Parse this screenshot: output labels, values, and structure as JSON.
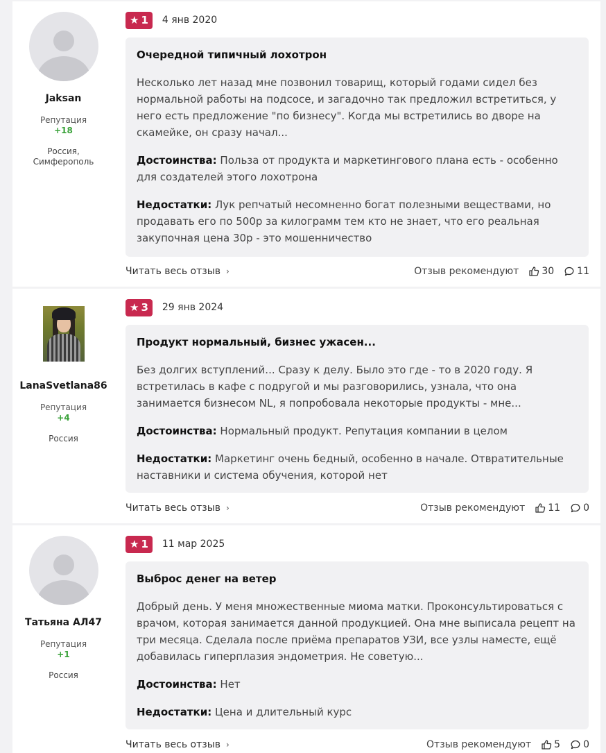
{
  "reviews": [
    {
      "author": {
        "name": "Jaksan",
        "reputation_label": "Репутация",
        "reputation": "+18",
        "location": "Россия, Симферополь"
      },
      "rating": "1",
      "date": "4 янв 2020",
      "title": "Очередной типичный лохотрон",
      "text": "Несколько лет назад мне позвонил товарищ, который годами сидел без нормальной работы на подсосе, и загадочно так предложил встретиться, у него есть предложение \"по бизнесу\". Когда мы встретились во дворе на скамейке, он сразу начал...",
      "pros_label": "Достоинства:",
      "pros": "Польза от продукта и маркетингового плана есть - особенно для создателей этого лохотрона",
      "cons_label": "Недостатки:",
      "cons": "Лук репчатый несомненно богат полезными веществами, но продавать его по 500р за килограмм тем кто не знает, что его реальная закупочная цена 30р - это мошенничество",
      "read_more": "Читать весь отзыв",
      "recommend_label": "Отзыв рекомендуют",
      "likes": "30",
      "comments": "11"
    },
    {
      "author": {
        "name": "LanaSvetlana86",
        "reputation_label": "Репутация",
        "reputation": "+4",
        "location": "Россия"
      },
      "rating": "3",
      "date": "29 янв 2024",
      "title": "Продукт нормальный, бизнес ужасен...",
      "text": "Без долгих вступлений... Сразу к делу. Было это где - то в 2020 году. Я встретилась в кафе с подругой и мы разговорились, узнала, что она занимается бизнесом NL, я попробовала некоторые продукты - мне...",
      "pros_label": "Достоинства:",
      "pros": "Нормальный продукт. Репутация компании в целом",
      "cons_label": "Недостатки:",
      "cons": "Маркетинг очень бедный, особенно в начале. Отвратительные наставники и система обучения, которой нет",
      "read_more": "Читать весь отзыв",
      "recommend_label": "Отзыв рекомендуют",
      "likes": "11",
      "comments": "0"
    },
    {
      "author": {
        "name": "Татьяна АЛ47",
        "reputation_label": "Репутация",
        "reputation": "+1",
        "location": "Россия"
      },
      "rating": "1",
      "date": "11 мар 2025",
      "title": "Выброс денег на ветер",
      "text": "Добрый день. У меня множественные миома матки. Проконсультироваться с врачом, которая занимается данной продукцией. Она мне выписала рецепт на три месяца. Сделала после приёма препаратов УЗИ, все узлы наместе, ещё добавилась гиперплазия эндометрия. Не советую...",
      "pros_label": "Достоинства:",
      "pros": "Нет",
      "cons_label": "Недостатки:",
      "cons": "Цена и длительный курс",
      "read_more": "Читать весь отзыв",
      "recommend_label": "Отзыв рекомендуют",
      "likes": "5",
      "comments": "0"
    }
  ],
  "colors": {
    "rating_badge": "#c8294f",
    "reputation_positive": "#3aa23a",
    "card_bg": "#f1f1f3"
  },
  "icons": {
    "star": "star-icon",
    "like": "thumb-up-icon",
    "comment": "comment-bubble-icon",
    "chevron": "chevron-right-icon"
  }
}
